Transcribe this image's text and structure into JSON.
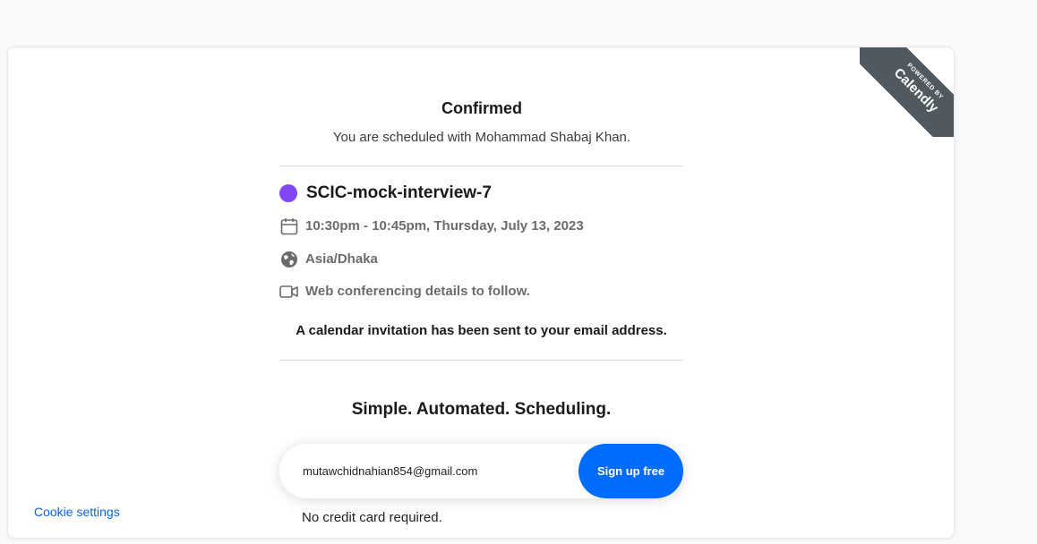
{
  "badge": {
    "powered": "POWERED BY",
    "brand": "Calendly"
  },
  "header": {
    "title": "Confirmed",
    "subtitle": "You are scheduled with Mohammad Shabaj Khan."
  },
  "event": {
    "name": "SCIC-mock-interview-7",
    "dot_color": "#8247f5",
    "details": [
      {
        "icon": "calendar-icon",
        "text": "10:30pm - 10:45pm, Thursday, July 13, 2023"
      },
      {
        "icon": "globe-icon",
        "text": "Asia/Dhaka"
      },
      {
        "icon": "video-camera-icon",
        "text": "Web conferencing details to follow."
      }
    ]
  },
  "invite_notice": "A calendar invitation has been sent to your email address.",
  "promo": {
    "slogan": "Simple. Automated. Scheduling.",
    "email_value": "mutawchidnahian854@gmail.com",
    "button_label": "Sign up free",
    "button_color": "#006bff",
    "note": "No credit card required."
  },
  "footer": {
    "cookie_settings": "Cookie settings",
    "link_color": "#0a66d8"
  }
}
